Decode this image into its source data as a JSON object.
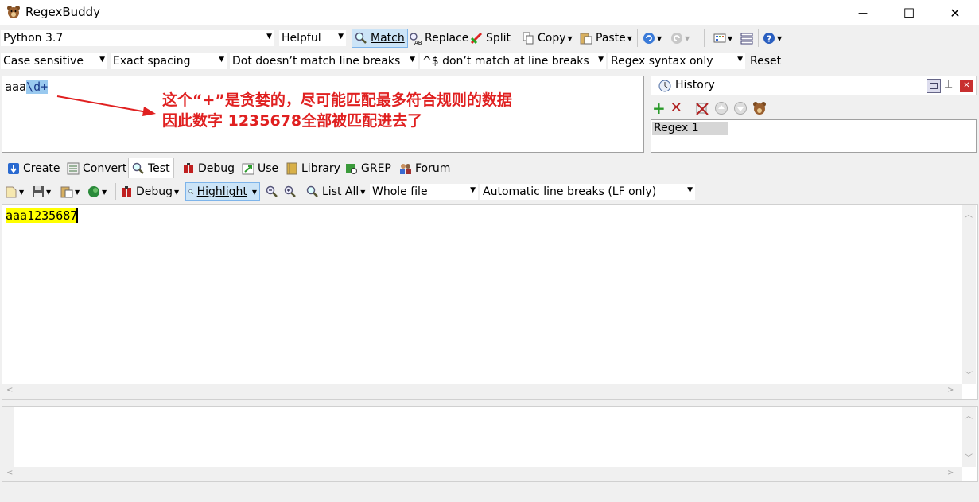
{
  "window": {
    "title": "RegexBuddy",
    "minimize_glyph": "—",
    "maximize_glyph": "☐",
    "close_glyph": "✕"
  },
  "toolbar1": {
    "flavor": "Python 3.7",
    "helpful": "Helpful",
    "match": "Match",
    "replace": "Replace",
    "split": "Split",
    "copy": "Copy",
    "paste": "Paste"
  },
  "toolbar2": {
    "case": "Case sensitive",
    "spacing": "Exact spacing",
    "dot": "Dot doesn’t match line breaks",
    "anchors": "^$ don’t match at line breaks",
    "syntax": "Regex syntax only",
    "reset": "Reset"
  },
  "regex": {
    "literal": "aaa",
    "selected": "\\d+"
  },
  "annotation": {
    "line1": "这个“+”是贪婪的，尽可能匹配最多符合规则的数据",
    "line2": "因此数字 1235678全部被匹配进去了"
  },
  "history": {
    "title": "History",
    "items": [
      "Regex 1"
    ]
  },
  "tabs": [
    "Create",
    "Convert",
    "Test",
    "Debug",
    "Use",
    "Library",
    "GREP",
    "Forum"
  ],
  "test_toolbar": {
    "debug": "Debug",
    "highlight": "Highlight",
    "list_all": "List All",
    "scope": "Whole file",
    "line_breaks": "Automatic line breaks (LF only)"
  },
  "test": {
    "subject": "aaa1235687"
  },
  "colors": {
    "selection": "#99c9ef",
    "highlight": "#ffff00",
    "annotation": "#e02020",
    "pressed_button": "#cce4f7"
  }
}
